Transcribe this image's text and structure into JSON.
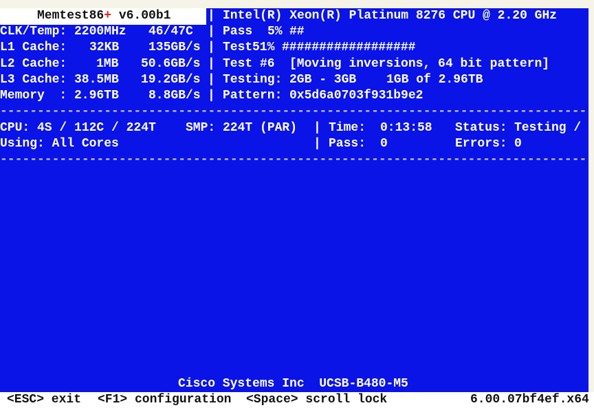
{
  "header": {
    "app_name": "Memtest86",
    "plus": "+",
    "version": " v6.00b1",
    "cpu_name": "Intel(R) Xeon(R) Platinum 8276 CPU @ 2.20 GHz"
  },
  "sysinfo": [
    {
      "label": "CLK/Temp:",
      "value": "2200MHz",
      "value2": "46/47C"
    },
    {
      "label": "L1 Cache:",
      "value": "32KB",
      "value2": "135GB/s"
    },
    {
      "label": "L2 Cache:",
      "value": "1MB",
      "value2": "50.6GB/s"
    },
    {
      "label": "L3 Cache:",
      "value": "38.5MB",
      "value2": "19.2GB/s"
    },
    {
      "label": "Memory  :",
      "value": "2.96TB",
      "value2": "8.8GB/s"
    }
  ],
  "progress": {
    "pass_label": "Pass",
    "pass_percent": "5%",
    "pass_bar": "##",
    "test_label": "Test",
    "test_percent": "51%",
    "test_bar": "##################",
    "test_num_label": "Test #6",
    "test_name": "[Moving inversions, 64 bit pattern]",
    "testing_label": "Testing:",
    "testing_range": "2GB - 3GB",
    "testing_amount": "1GB of 2.96TB",
    "pattern_label": "Pattern:",
    "pattern_value": "0x5d6a0703f931b9e2"
  },
  "separator": "|",
  "dashes": "-------------------------------------------------------------------------------",
  "status": {
    "cpu": "CPU: 4S / 112C / 224T",
    "smp": "SMP: 224T (PAR)",
    "time_label": "Time:",
    "time_value": "0:13:58",
    "status_label": "Status:",
    "status_value": "Testing /",
    "using": "Using: All Cores",
    "pass_label": "Pass:",
    "pass_value": "0",
    "errors_label": "Errors:",
    "errors_value": "0"
  },
  "footer": {
    "system": "Cisco Systems Inc  UCSB-B480-M5",
    "esc": "<ESC> exit",
    "f1": "<F1> configuration",
    "space": "<Space> scroll lock",
    "build": "6.00.07bf4ef.x64"
  }
}
